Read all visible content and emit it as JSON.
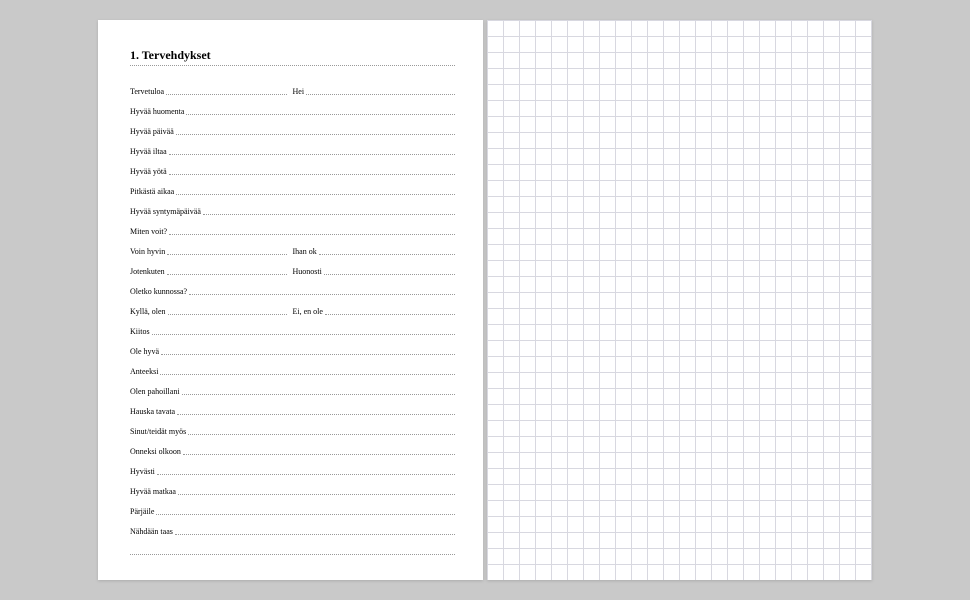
{
  "title": "1. Tervehdykset",
  "rows": [
    {
      "type": "pair",
      "a": "Tervetuloa",
      "b": "Hei"
    },
    {
      "type": "single",
      "a": "Hyvää huomenta"
    },
    {
      "type": "single",
      "a": "Hyvää päivää"
    },
    {
      "type": "single",
      "a": "Hyvää iltaa"
    },
    {
      "type": "single",
      "a": "Hyvää yötä"
    },
    {
      "type": "single",
      "a": "Pitkästä aikaa"
    },
    {
      "type": "single",
      "a": "Hyvää syntymäpäivää"
    },
    {
      "type": "single",
      "a": "Miten voit?"
    },
    {
      "type": "pair",
      "a": "Voin hyvin",
      "b": "Ihan ok"
    },
    {
      "type": "pair",
      "a": "Jotenkuten",
      "b": "Huonosti"
    },
    {
      "type": "single",
      "a": "Oletko kunnossa?"
    },
    {
      "type": "pair",
      "a": "Kyllä, olen",
      "b": "Ei, en ole"
    },
    {
      "type": "single",
      "a": "Kiitos"
    },
    {
      "type": "single",
      "a": "Ole hyvä"
    },
    {
      "type": "single",
      "a": "Anteeksi"
    },
    {
      "type": "single",
      "a": "Olen pahoillani"
    },
    {
      "type": "single",
      "a": "Hauska tavata"
    },
    {
      "type": "single",
      "a": "Sinut/teidät myös"
    },
    {
      "type": "single",
      "a": "Onneksi olkoon"
    },
    {
      "type": "single",
      "a": "Hyvästi"
    },
    {
      "type": "single",
      "a": "Hyvää matkaa"
    },
    {
      "type": "single",
      "a": "Pärjäile"
    },
    {
      "type": "single",
      "a": "Nähdään taas"
    },
    {
      "type": "blank"
    }
  ]
}
